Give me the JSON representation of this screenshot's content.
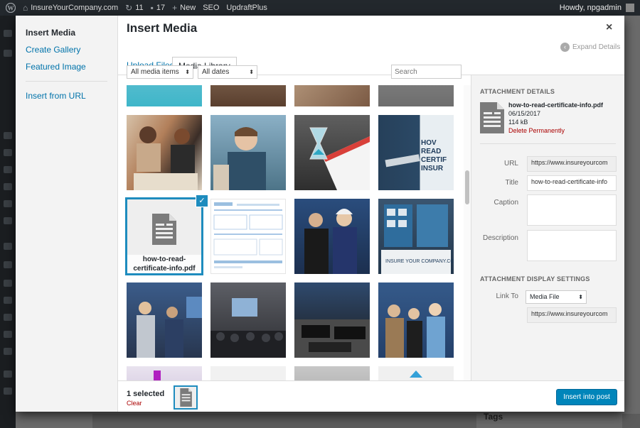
{
  "adminbar": {
    "site": "InsureYourCompany.com",
    "updates": "11",
    "comments": "17",
    "new": "New",
    "seo": "SEO",
    "plugin": "UpdraftPlus",
    "howdy": "Howdy, npgadmin"
  },
  "menu": {
    "insert_media": "Insert Media",
    "create_gallery": "Create Gallery",
    "featured_image": "Featured Image",
    "insert_url": "Insert from URL"
  },
  "modal": {
    "title": "Insert Media",
    "close": "×",
    "tab_upload": "Upload Files",
    "tab_library": "Media Library",
    "expand": "Expand Details"
  },
  "toolbar": {
    "filter_type": "All media items",
    "filter_date": "All dates",
    "search_placeholder": "Search"
  },
  "selected_item": {
    "name": "how-to-read-certificate-info.pdf",
    "check": "✓"
  },
  "attachment": {
    "heading": "Attachment Details",
    "filename": "how-to-read-certificate-info.pdf",
    "date": "06/15/2017",
    "size": "114 kB",
    "delete": "Delete Permanently",
    "url_label": "URL",
    "url_value": "https://www.insureyourcom",
    "title_label": "Title",
    "title_value": "how-to-read-certificate-info",
    "caption_label": "Caption",
    "description_label": "Description",
    "display_heading": "Attachment Display Settings",
    "link_to_label": "Link To",
    "link_to_value": "Media File",
    "link_url": "https://www.insureyourcom"
  },
  "bottom": {
    "count": "1 selected",
    "clear": "Clear",
    "insert": "Insert into post"
  },
  "background": {
    "tags": "Tags"
  },
  "colors": {
    "accent": "#0073aa",
    "primary_button": "#0085ba",
    "selection": "#1e8cbe",
    "delete": "#aa0000"
  }
}
